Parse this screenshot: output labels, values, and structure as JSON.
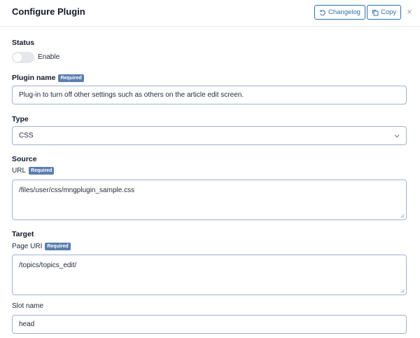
{
  "header": {
    "title": "Configure Plugin",
    "changelog_label": "Changelog",
    "copy_label": "Copy",
    "close_glyph": "×"
  },
  "status": {
    "label": "Status",
    "toggle_text": "Enable",
    "enabled": false
  },
  "plugin_name": {
    "label": "Plugin name",
    "badge": "Required",
    "value": "Plug-in to turn off other settings such as others on the article edit screen."
  },
  "type": {
    "label": "Type",
    "value": "CSS"
  },
  "source": {
    "label": "Source",
    "url_label": "URL",
    "url_badge": "Required",
    "url_value": "/files/user/css/mngplugin_sample.css"
  },
  "target": {
    "label": "Target",
    "page_uri_label": "Page URI",
    "page_uri_badge": "Required",
    "page_uri_value": "/topics/topics_edit/",
    "slot_label": "Slot name",
    "slot_value": "head"
  },
  "colors": {
    "accent": "#2f6fb0",
    "badge": "#5b7eb0",
    "input_border": "#9fb3cf"
  }
}
